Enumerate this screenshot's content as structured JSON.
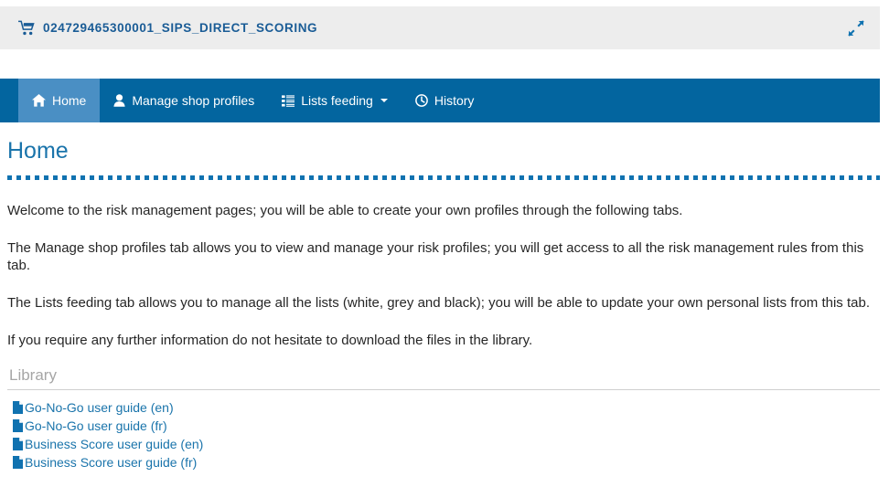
{
  "header": {
    "cart_icon": "shopping-cart-icon",
    "merchant_id": "024729465300001_SIPS_DIRECT_SCORING",
    "expand_icon": "expand-diagonal-icon",
    "background_color": "#ededed",
    "text_color": "#1a5c96"
  },
  "nav": {
    "background_color": "#03659f",
    "active_color": "#4a8fc4",
    "items": [
      {
        "label": "Home",
        "icon": "home-icon",
        "active": true,
        "has_dropdown": false
      },
      {
        "label": "Manage shop profiles",
        "icon": "user-icon",
        "active": false,
        "has_dropdown": false
      },
      {
        "label": "Lists feeding",
        "icon": "list-icon",
        "active": false,
        "has_dropdown": true
      },
      {
        "label": "History",
        "icon": "clock-icon",
        "active": false,
        "has_dropdown": false
      }
    ]
  },
  "main": {
    "page_title": "Home",
    "title_color": "#1a74ab",
    "divider_color": "#1072b0",
    "paragraphs": [
      "Welcome to the risk management pages; you will be able to create your own profiles through the following tabs.",
      "The Manage shop profiles tab allows you to view and manage your risk profiles; you will get access to all the risk management rules from this tab.",
      "The Lists feeding tab allows you to manage all the lists (white, grey and black); you will be able to update your own personal lists from this tab.",
      "If you require any further information do not hesitate to download the files in the library."
    ]
  },
  "library": {
    "heading": "Library",
    "heading_color": "#a6a6a6",
    "link_color": "#1a74ab",
    "items": [
      {
        "label": "Go-No-Go user guide (en)",
        "icon": "file-document-icon"
      },
      {
        "label": "Go-No-Go user guide (fr)",
        "icon": "file-document-icon"
      },
      {
        "label": "Business Score user guide (en)",
        "icon": "file-document-icon"
      },
      {
        "label": "Business Score user guide (fr)",
        "icon": "file-document-icon"
      }
    ]
  }
}
